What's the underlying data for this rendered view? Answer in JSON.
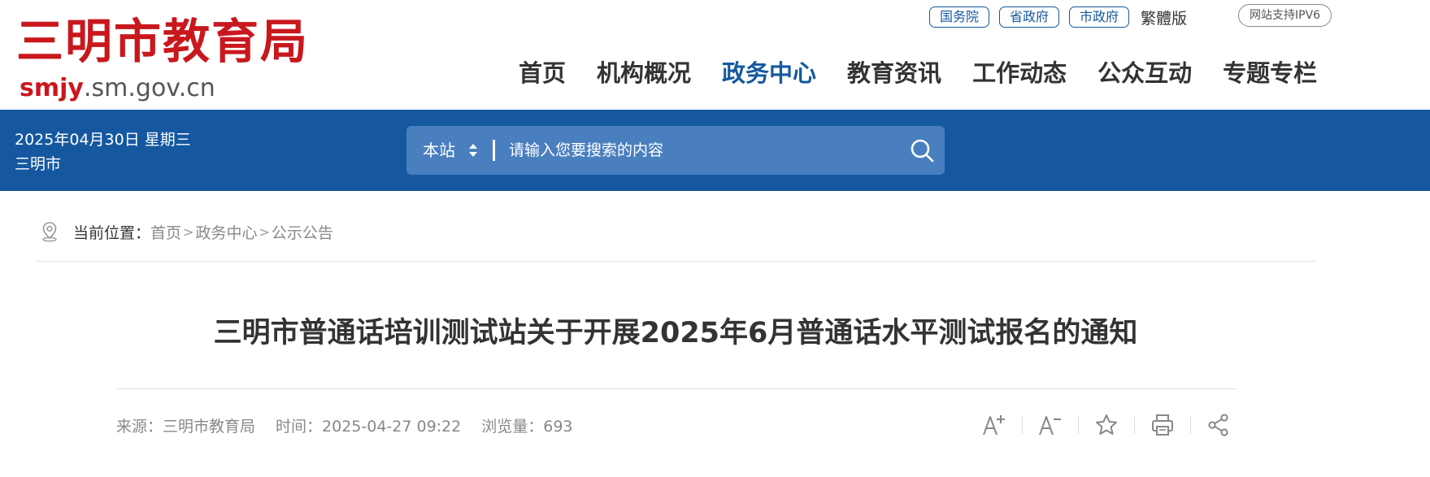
{
  "header": {
    "logo_text": "三明市教育局",
    "domain_highlight": "smjy",
    "domain_rest": ".sm.gov.cn",
    "top_links": [
      "国务院",
      "省政府",
      "市政府"
    ],
    "traditional": "繁體版",
    "ipv6_badge": "网站支持IPV6"
  },
  "nav": {
    "items": [
      "首页",
      "机构概况",
      "政务中心",
      "教育资讯",
      "工作动态",
      "公众互动",
      "专题专栏"
    ],
    "active": "政务中心"
  },
  "band": {
    "date": "2025年04月30日 星期三",
    "city": "三明市",
    "search_scope": "本站",
    "search_placeholder": "请输入您要搜索的内容"
  },
  "breadcrumb": {
    "label": "当前位置：",
    "items": [
      "首页",
      "政务中心",
      "公示公告"
    ],
    "separator": ">"
  },
  "article": {
    "title": "三明市普通话培训测试站关于开展2025年6月普通话水平测试报名的通知",
    "source": "来源：三明市教育局",
    "time": "时间：2025-04-27 09:22",
    "views": "浏览量：693"
  },
  "tools": {
    "icons": [
      "font-increase-icon",
      "font-decrease-icon",
      "star-icon",
      "print-icon",
      "share-icon"
    ]
  },
  "colors": {
    "brand_blue": "#1558a0",
    "logo_red": "#c9171e",
    "search_bg": "#4a7fbf"
  }
}
